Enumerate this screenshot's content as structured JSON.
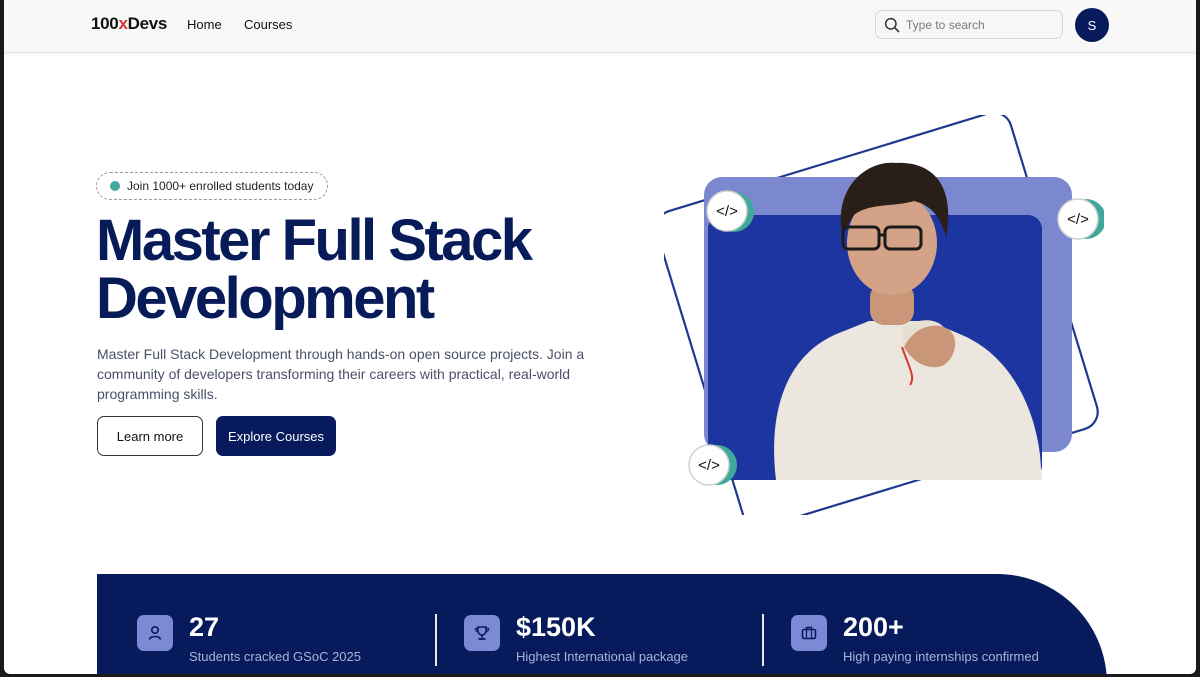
{
  "header": {
    "logo_prefix": "100",
    "logo_x": "x",
    "logo_suffix": "Devs",
    "nav": [
      "Home",
      "Courses"
    ],
    "search_placeholder": "Type to search",
    "avatar_initial": "S"
  },
  "hero": {
    "badge": "Join 1000+ enrolled students today",
    "title_line1": "Master Full Stack",
    "title_line2": "Development",
    "description": "Master Full Stack Development through hands-on open source projects. Join a community of developers transforming their careers with practical, real-world programming skills.",
    "btn_learn": "Learn more",
    "btn_explore": "Explore Courses",
    "code_badge": "</>"
  },
  "stats": [
    {
      "icon": "user-icon",
      "value": "27",
      "label": "Students cracked GSoC 2025"
    },
    {
      "icon": "trophy-icon",
      "value": "$150K",
      "label": "Highest International package"
    },
    {
      "icon": "briefcase-icon",
      "value": "200+",
      "label": "High paying internships confirmed"
    }
  ],
  "colors": {
    "brand_navy": "#061a5c",
    "accent_teal": "#3fa89a",
    "logo_x_red": "#d6332a"
  }
}
